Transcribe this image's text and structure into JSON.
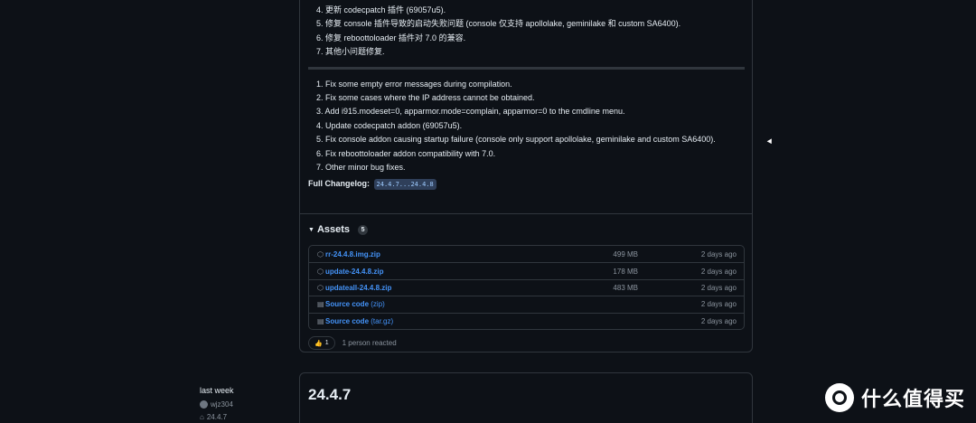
{
  "release": {
    "notes_zh": [
      "4. 更新 codecpatch 插件 (69057u5).",
      "5. 修复 console 插件导致的启动失败问题 (console 仅支持 apollolake, geminilake 和 custom SA6400).",
      "6. 修复 reboottoloader 插件对 7.0 的兼容.",
      "7. 其他小问题修复."
    ],
    "notes_en": [
      "1. Fix some empty error messages during compilation.",
      "2. Fix some cases where the IP address cannot be obtained.",
      "3. Add i915.modeset=0, apparmor.mode=complain, apparmor=0 to the cmdline menu.",
      "4. Update codecpatch addon (69057u5).",
      "5. Fix console addon causing startup failure (console only support apollolake, geminilake and custom SA6400).",
      "6. Fix reboottoloader addon compatibility with 7.0.",
      "7. Other minor bug fixes."
    ],
    "changelog_label": "Full Changelog:",
    "changelog_range": "24.4.7...24.4.8"
  },
  "assets": {
    "title": "Assets",
    "count": "5",
    "rows": [
      {
        "icon": "package-icon",
        "name": "rr-24.4.8.img.zip",
        "suffix": "",
        "size": "499 MB",
        "date": "2 days ago"
      },
      {
        "icon": "package-icon",
        "name": "update-24.4.8.zip",
        "suffix": "",
        "size": "178 MB",
        "date": "2 days ago"
      },
      {
        "icon": "package-icon",
        "name": "updateall-24.4.8.zip",
        "suffix": "",
        "size": "483 MB",
        "date": "2 days ago"
      },
      {
        "icon": "file-zip-icon",
        "name": "Source code",
        "suffix": "(zip)",
        "size": "",
        "date": "2 days ago"
      },
      {
        "icon": "file-zip-icon",
        "name": "Source code",
        "suffix": "(tar.gz)",
        "size": "",
        "date": "2 days ago"
      }
    ]
  },
  "reactions": {
    "emoji": "👍",
    "count": "1",
    "summary": "1 person reacted"
  },
  "next_release": {
    "title": "24.4.7",
    "sidebar_time": "last week",
    "author": "wjz304",
    "tag": "24.4.7"
  },
  "watermark": {
    "text": "什么值得买"
  },
  "colors": {
    "background": "#0d1117",
    "border": "#30363d",
    "link": "#4493f8",
    "muted": "#8b949e"
  }
}
